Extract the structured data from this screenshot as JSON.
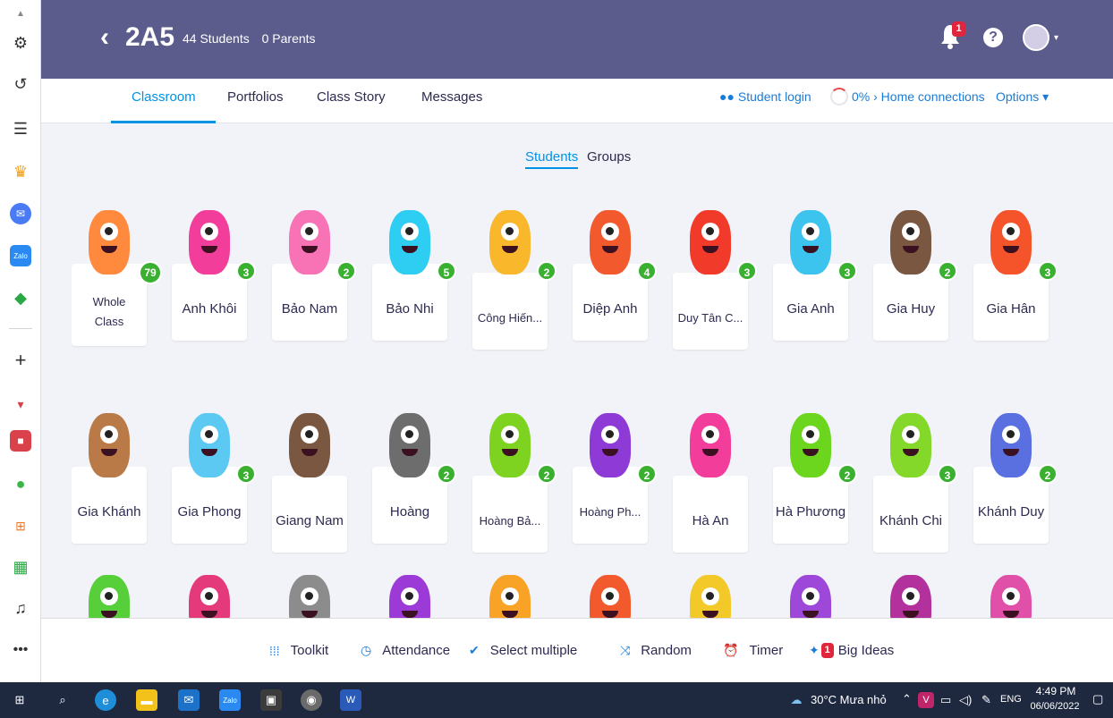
{
  "header": {
    "class_name": "2A5",
    "students_count": "44 Students",
    "parents_count": "0 Parents",
    "notification_badge": "1",
    "help_glyph": "?",
    "avatar_caret": "▾",
    "back_glyph": "‹"
  },
  "nav": {
    "tabs": [
      "Classroom",
      "Portfolios",
      "Class Story",
      "Messages"
    ],
    "student_login": "Student login",
    "home_connections": "0% › Home connections",
    "options": "Options ▾"
  },
  "switch": {
    "students": "Students",
    "groups": "Groups"
  },
  "students": [
    {
      "name": "Whole Class",
      "points": "79",
      "color": "#ff8a3d"
    },
    {
      "name": "Anh Khôi",
      "points": "3",
      "color": "#f23d9a"
    },
    {
      "name": "Bảo Nam",
      "points": "2",
      "color": "#f773b6"
    },
    {
      "name": "Bảo Nhi",
      "points": "5",
      "color": "#2ecdf2"
    },
    {
      "name": "Công Hiến...",
      "points": "2",
      "color": "#f9b82c"
    },
    {
      "name": "Diệp Anh",
      "points": "4",
      "color": "#f25a2e"
    },
    {
      "name": "Duy Tân C...",
      "points": "3",
      "color": "#f23a2a"
    },
    {
      "name": "Gia Anh",
      "points": "3",
      "color": "#3cc3ee"
    },
    {
      "name": "Gia Huy",
      "points": "2",
      "color": "#7a5740"
    },
    {
      "name": "Gia Hân",
      "points": "3",
      "color": "#f5542a"
    },
    {
      "name": "Gia Khánh",
      "points": "",
      "color": "#b97a48"
    },
    {
      "name": "Gia Phong",
      "points": "3",
      "color": "#5cc9f2"
    },
    {
      "name": "Giang Nam",
      "points": "",
      "color": "#7a5740"
    },
    {
      "name": "Hoàng",
      "points": "2",
      "color": "#6d6d6d"
    },
    {
      "name": "Hoàng Bả...",
      "points": "2",
      "color": "#7ed321"
    },
    {
      "name": "Hoàng Ph...",
      "points": "2",
      "color": "#8e3ad6"
    },
    {
      "name": "Hà An",
      "points": "",
      "color": "#f23d9a"
    },
    {
      "name": "Hà Phương",
      "points": "2",
      "color": "#6cd61e"
    },
    {
      "name": "Khánh Chi",
      "points": "3",
      "color": "#83d82a"
    },
    {
      "name": "Khánh Duy",
      "points": "2",
      "color": "#5a6fe0"
    },
    {
      "name": "",
      "points": "",
      "color": "#56cf3b"
    },
    {
      "name": "",
      "points": "",
      "color": "#e43a7c"
    },
    {
      "name": "",
      "points": "",
      "color": "#8c8c8c"
    },
    {
      "name": "",
      "points": "",
      "color": "#9b3ad6"
    },
    {
      "name": "",
      "points": "",
      "color": "#f9a326"
    },
    {
      "name": "",
      "points": "",
      "color": "#f25a2e"
    },
    {
      "name": "",
      "points": "",
      "color": "#f3c92a"
    },
    {
      "name": "",
      "points": "",
      "color": "#9d48d8"
    },
    {
      "name": "",
      "points": "",
      "color": "#b2319c"
    },
    {
      "name": "",
      "points": "",
      "color": "#e04fa8"
    }
  ],
  "toolbar": {
    "toolkit": "Toolkit",
    "attendance": "Attendance",
    "select_multiple": "Select multiple",
    "random": "Random",
    "timer": "Timer",
    "big_ideas": "Big Ideas",
    "big_ideas_badge": "1"
  },
  "taskbar": {
    "weather": "30°C  Mưa nhỏ",
    "language": "ENG",
    "time": "4:49 PM",
    "date": "06/06/2022"
  }
}
